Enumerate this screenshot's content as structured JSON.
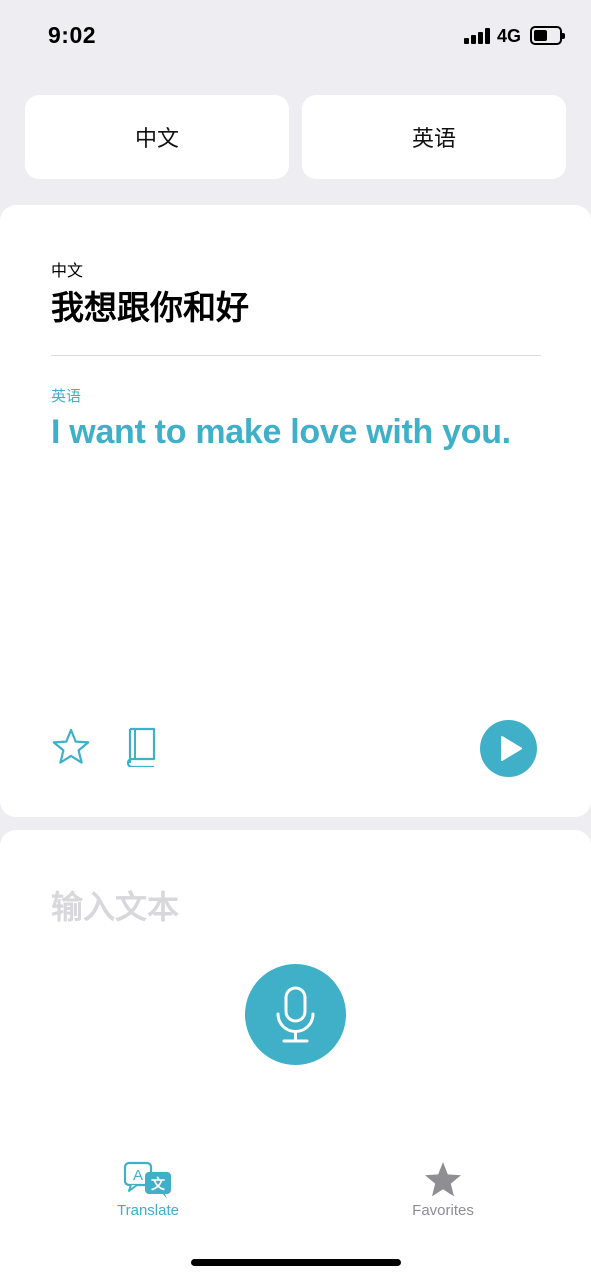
{
  "status_bar": {
    "time": "9:02",
    "network": "4G",
    "battery_level": 0.45
  },
  "languages": {
    "source_button": "中文",
    "target_button": "英语"
  },
  "result": {
    "source_label": "中文",
    "source_text": "我想跟你和好",
    "target_label": "英语",
    "target_text": "I want to make love with you."
  },
  "input": {
    "placeholder": "输入文本"
  },
  "tabs": [
    {
      "label": "Translate",
      "icon": "translate-icon",
      "active": true
    },
    {
      "label": "Favorites",
      "icon": "star-filled-icon",
      "active": false
    }
  ],
  "colors": {
    "accent": "#3fb0c8",
    "inactive": "#8e8e93",
    "background": "#eeeef2"
  }
}
